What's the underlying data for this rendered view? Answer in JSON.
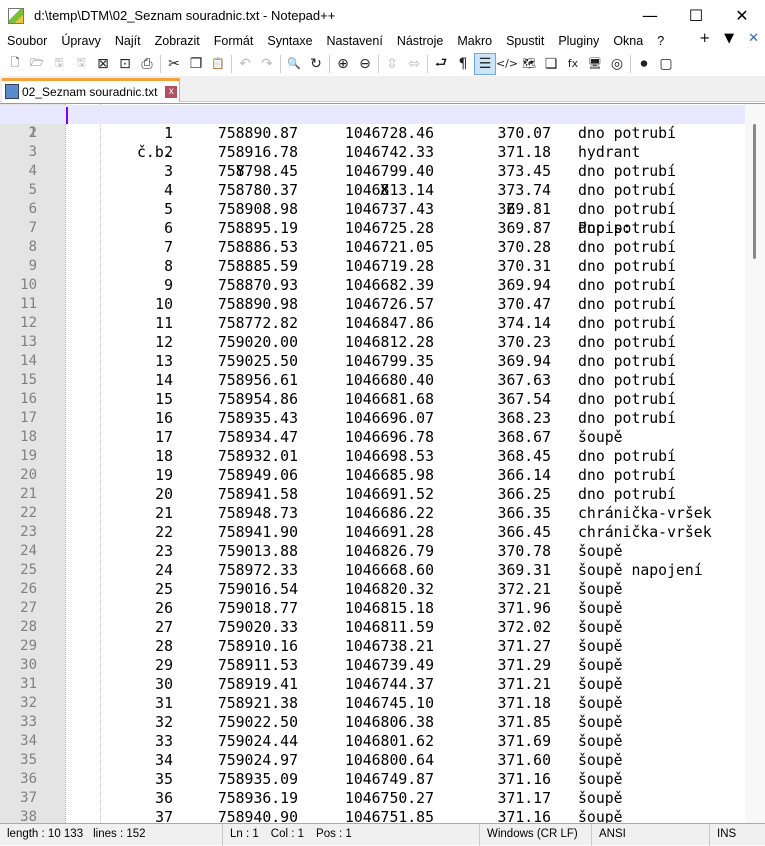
{
  "window": {
    "title": "d:\\temp\\DTM\\02_Seznam souradnic.txt - Notepad++",
    "minimize": "—",
    "maximize": "☐",
    "close": "✕"
  },
  "menu": {
    "items": [
      "Soubor",
      "Úpravy",
      "Najít",
      "Zobrazit",
      "Formát",
      "Syntaxe",
      "Nastavení",
      "Nástroje",
      "Makro",
      "Spustit",
      "Pluginy",
      "Okna",
      "?"
    ],
    "right": [
      "+",
      "▼",
      "✕"
    ]
  },
  "toolbar": {
    "icons": [
      {
        "name": "new-file-icon",
        "glyph": "🗋"
      },
      {
        "name": "open-folder-icon",
        "glyph": "🗁"
      },
      {
        "name": "save-icon",
        "glyph": "🖫",
        "disabled": true
      },
      {
        "name": "save-all-icon",
        "glyph": "🖫",
        "disabled": true
      },
      {
        "name": "close-icon",
        "glyph": "⊠"
      },
      {
        "name": "close-all-icon",
        "glyph": "⊡"
      },
      {
        "name": "print-icon",
        "glyph": "⎙"
      },
      "sep",
      {
        "name": "cut-icon",
        "glyph": "✂"
      },
      {
        "name": "copy-icon",
        "glyph": "❐"
      },
      {
        "name": "paste-icon",
        "glyph": "📋"
      },
      "sep",
      {
        "name": "undo-icon",
        "glyph": "↶",
        "disabled": true
      },
      {
        "name": "redo-icon",
        "glyph": "↷",
        "disabled": true
      },
      "sep",
      {
        "name": "find-icon",
        "glyph": "🔍"
      },
      {
        "name": "replace-icon",
        "glyph": "↻"
      },
      "sep",
      {
        "name": "zoom-in-icon",
        "glyph": "⊕"
      },
      {
        "name": "zoom-out-icon",
        "glyph": "⊖"
      },
      "sep",
      {
        "name": "sync-vertical-icon",
        "glyph": "⇳",
        "disabled": true
      },
      {
        "name": "sync-horizontal-icon",
        "glyph": "⬄",
        "disabled": true
      },
      "sep",
      {
        "name": "word-wrap-icon",
        "glyph": "⮐"
      },
      {
        "name": "show-all-chars-icon",
        "glyph": "¶"
      },
      {
        "name": "indent-guide-icon",
        "glyph": "☰",
        "active": true
      },
      {
        "name": "xml-tag-icon",
        "glyph": "</>"
      },
      {
        "name": "document-map-icon",
        "glyph": "🗺"
      },
      {
        "name": "document-list-icon",
        "glyph": "❏"
      },
      {
        "name": "function-list-icon",
        "glyph": "fx"
      },
      {
        "name": "folder-workspace-icon",
        "glyph": "🖥"
      },
      {
        "name": "monitoring-icon",
        "glyph": "◎"
      },
      "sep",
      {
        "name": "record-macro-icon",
        "glyph": "⏺"
      },
      {
        "name": "stop-macro-icon",
        "glyph": "▢"
      }
    ]
  },
  "tab": {
    "label": "02_Seznam souradnic.txt",
    "close": "x"
  },
  "header": {
    "line": "1",
    "cb": "č.b.",
    "y": "Y",
    "x": "X",
    "z": "Z",
    "popis": "Popis:"
  },
  "rows": [
    [
      "1",
      "758890.87",
      "1046728.46",
      "370.07",
      "dno potrubí"
    ],
    [
      "2",
      "758916.78",
      "1046742.33",
      "371.18",
      "hydrant"
    ],
    [
      "3",
      "758798.45",
      "1046799.40",
      "373.45",
      "dno potrubí"
    ],
    [
      "4",
      "758780.37",
      "1046813.14",
      "373.74",
      "dno potrubí"
    ],
    [
      "5",
      "758908.98",
      "1046737.43",
      "369.81",
      "dno potrubí"
    ],
    [
      "6",
      "758895.19",
      "1046725.28",
      "369.87",
      "dno potrubí"
    ],
    [
      "7",
      "758886.53",
      "1046721.05",
      "370.28",
      "dno potrubí"
    ],
    [
      "8",
      "758885.59",
      "1046719.28",
      "370.31",
      "dno potrubí"
    ],
    [
      "9",
      "758870.93",
      "1046682.39",
      "369.94",
      "dno potrubí"
    ],
    [
      "10",
      "758890.98",
      "1046726.57",
      "370.47",
      "dno potrubí"
    ],
    [
      "11",
      "758772.82",
      "1046847.86",
      "374.14",
      "dno potrubí"
    ],
    [
      "12",
      "759020.00",
      "1046812.28",
      "370.23",
      "dno potrubí"
    ],
    [
      "13",
      "759025.50",
      "1046799.35",
      "369.94",
      "dno potrubí"
    ],
    [
      "14",
      "758956.61",
      "1046680.40",
      "367.63",
      "dno potrubí"
    ],
    [
      "15",
      "758954.86",
      "1046681.68",
      "367.54",
      "dno potrubí"
    ],
    [
      "16",
      "758935.43",
      "1046696.07",
      "368.23",
      "dno potrubí"
    ],
    [
      "17",
      "758934.47",
      "1046696.78",
      "368.67",
      "šoupě"
    ],
    [
      "18",
      "758932.01",
      "1046698.53",
      "368.45",
      "dno potrubí"
    ],
    [
      "19",
      "758949.06",
      "1046685.98",
      "366.14",
      "dno potrubí"
    ],
    [
      "20",
      "758941.58",
      "1046691.52",
      "366.25",
      "dno potrubí"
    ],
    [
      "21",
      "758948.73",
      "1046686.22",
      "366.35",
      "chránička-vršek"
    ],
    [
      "22",
      "758941.90",
      "1046691.28",
      "366.45",
      "chránička-vršek"
    ],
    [
      "23",
      "759013.88",
      "1046826.79",
      "370.78",
      "šoupě"
    ],
    [
      "24",
      "758972.33",
      "1046668.60",
      "369.31",
      "šoupě napojení"
    ],
    [
      "25",
      "759016.54",
      "1046820.32",
      "372.21",
      "šoupě"
    ],
    [
      "26",
      "759018.77",
      "1046815.18",
      "371.96",
      "šoupě"
    ],
    [
      "27",
      "759020.33",
      "1046811.59",
      "372.02",
      "šoupě"
    ],
    [
      "28",
      "758910.16",
      "1046738.21",
      "371.27",
      "šoupě"
    ],
    [
      "29",
      "758911.53",
      "1046739.49",
      "371.29",
      "šoupě"
    ],
    [
      "30",
      "758919.41",
      "1046744.37",
      "371.21",
      "šoupě"
    ],
    [
      "31",
      "758921.38",
      "1046745.10",
      "371.18",
      "šoupě"
    ],
    [
      "32",
      "759022.50",
      "1046806.38",
      "371.85",
      "šoupě"
    ],
    [
      "33",
      "759024.44",
      "1046801.62",
      "371.69",
      "šoupě"
    ],
    [
      "34",
      "759024.97",
      "1046800.64",
      "371.60",
      "šoupě"
    ],
    [
      "35",
      "758935.09",
      "1046749.87",
      "371.16",
      "šoupě"
    ],
    [
      "36",
      "758936.19",
      "1046750.27",
      "371.17",
      "šoupě"
    ],
    [
      "37",
      "758940.90",
      "1046751.85",
      "371.16",
      "šoupě"
    ]
  ],
  "status": {
    "length": "length : 10 133",
    "lines": "lines : 152",
    "ln": "Ln : 1",
    "col": "Col : 1",
    "pos": "Pos : 1",
    "eol": "Windows (CR LF)",
    "encoding": "ANSI",
    "mode": "INS"
  }
}
